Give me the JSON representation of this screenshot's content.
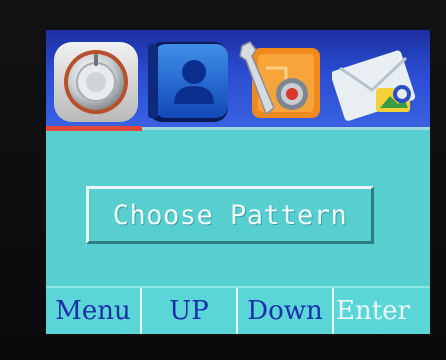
{
  "screen": {
    "title": "Choose Pattern",
    "icons": [
      {
        "name": "dial-knob-icon",
        "selected": true
      },
      {
        "name": "contacts-icon",
        "selected": false
      },
      {
        "name": "settings-tools-icon",
        "selected": false
      },
      {
        "name": "mail-icon",
        "selected": false
      }
    ]
  },
  "softkeys": {
    "menu": "Menu",
    "up": "UP",
    "down": "Down",
    "enter": "Enter"
  },
  "colors": {
    "background": "#57cfd1",
    "icon_bar": "#2a4bd0",
    "selection": "#e2473a",
    "softkey_text": "#1b2fa8"
  }
}
